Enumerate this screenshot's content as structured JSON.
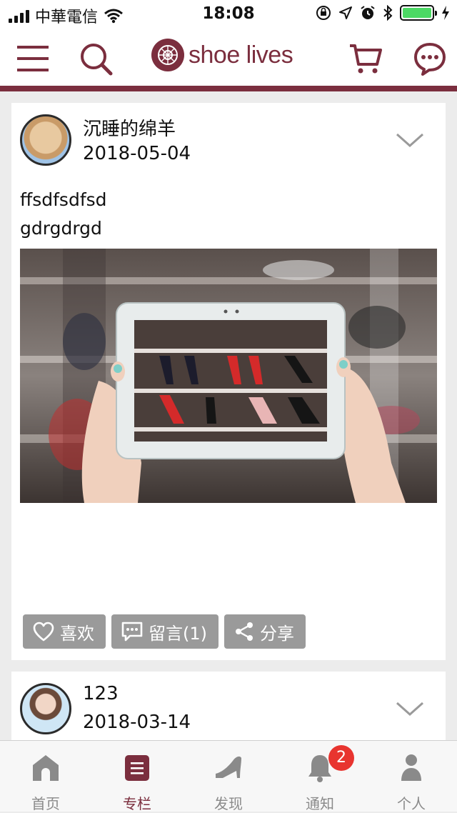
{
  "status_bar": {
    "carrier": "中華電信",
    "time": "18:08"
  },
  "header": {
    "logo_text": "shoe lives",
    "brand_color": "#7b2e3e"
  },
  "posts": [
    {
      "username": "沉睡的绵羊",
      "date": "2018-05-04",
      "text_lines": [
        "ffsdfsdfsd",
        "gdrgdrgd"
      ],
      "actions": {
        "like_label": "喜欢",
        "comment_label": "留言(1)",
        "share_label": "分享"
      }
    },
    {
      "username": "123",
      "date": "2018-03-14"
    }
  ],
  "tabbar": {
    "items": [
      {
        "label": "首页",
        "icon": "home-icon"
      },
      {
        "label": "专栏",
        "icon": "column-icon"
      },
      {
        "label": "发现",
        "icon": "heel-shoe-icon"
      },
      {
        "label": "通知",
        "icon": "bell-icon"
      },
      {
        "label": "个人",
        "icon": "person-icon"
      }
    ],
    "active_index": 1,
    "notification_badge": "2"
  }
}
